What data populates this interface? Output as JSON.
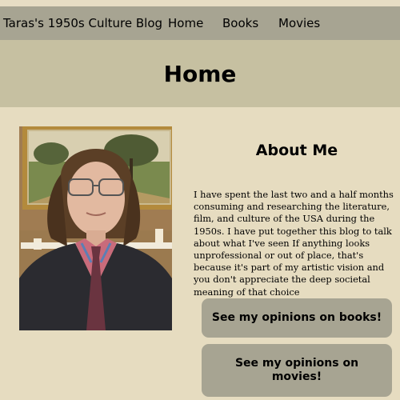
{
  "nav": {
    "brand": "Taras's 1950s Culture Blog",
    "links": [
      {
        "label": "Home"
      },
      {
        "label": "Books"
      },
      {
        "label": "Movies"
      }
    ]
  },
  "hero": {
    "title": "Home"
  },
  "about": {
    "heading": "About Me",
    "text": "I have spent the last two and a half months consuming and researching the literature, film, and culture of the USA during the 1950s. I have put together this blog to talk about what I've seen If anything looks unprofessional or out of place, that's because it's part of my artistic vision and you don't appreciate the deep societal meaning of that choice"
  },
  "buttons": {
    "books": "See my opinions on books!",
    "movies": "See my opinions on movies!"
  },
  "colors": {
    "page_background": "#e6dcc0",
    "nav_background": "#a7a492",
    "hero_background": "#c6c0a1",
    "button_background": "#a7a492"
  }
}
